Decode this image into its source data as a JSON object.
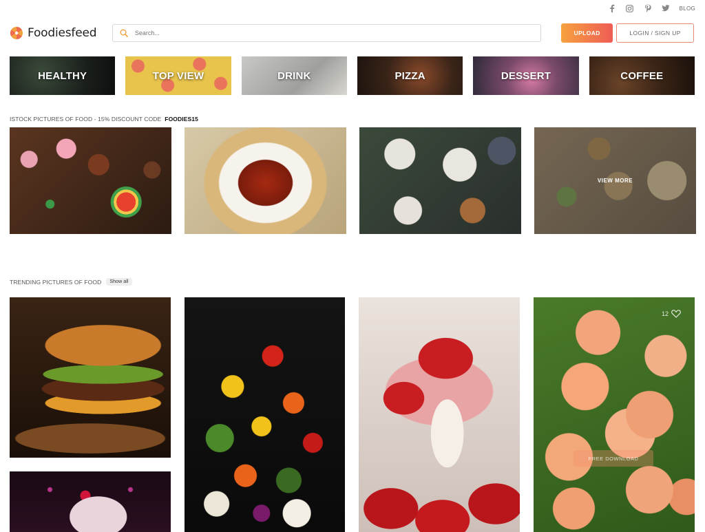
{
  "social": {
    "icons": [
      "facebook-icon",
      "instagram-icon",
      "pinterest-icon",
      "twitter-icon"
    ],
    "blog_label": "BLOG"
  },
  "header": {
    "logo_text": "Foodiesfeed",
    "search_placeholder": "Search...",
    "upload_label": "UPLOAD",
    "login_label": "LOGIN / SIGN UP"
  },
  "categories": [
    {
      "label": "HEALTHY"
    },
    {
      "label": "TOP VIEW"
    },
    {
      "label": "DRINK"
    },
    {
      "label": "PIZZA"
    },
    {
      "label": "DESSERT"
    },
    {
      "label": "COFFEE"
    }
  ],
  "istock": {
    "label": "ISTOCK PICTURES OF FOOD - 15% DISCOUNT CODE",
    "code": "FOODIES15",
    "view_more_label": "VIEW MORE"
  },
  "trending": {
    "label": "TRENDING PICTURES OF FOOD",
    "show_all_label": "Show all",
    "like_count": "12",
    "free_download_label": "FREE DOWNLOAD"
  },
  "colors": {
    "accent_start": "#f7a23f",
    "accent_end": "#ee5c55"
  }
}
